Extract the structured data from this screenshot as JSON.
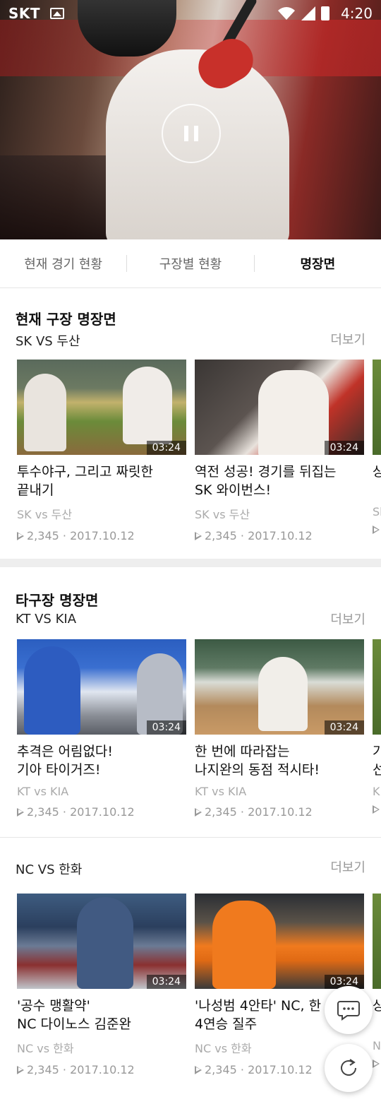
{
  "status_bar": {
    "carrier": "SKT",
    "time": "4:20"
  },
  "tabs": [
    {
      "label": "현재 경기 현황",
      "active": false
    },
    {
      "label": "구장별 현황",
      "active": false
    },
    {
      "label": "명장면",
      "active": true
    }
  ],
  "sections": [
    {
      "title": "현재 구장 명장면",
      "subtitle": "SK VS 두산",
      "more_label": "더보기",
      "cards": [
        {
          "title": "투수야구, 그리고 짜릿한\n끝내기",
          "match": "SK vs 두산",
          "views": "2,345",
          "date": "2017.10.12",
          "duration": "03:24"
        },
        {
          "title": "역전 성공! 경기를 뒤집는\nSK 와이번스!",
          "match": "SK vs 두산",
          "views": "2,345",
          "date": "2017.10.12",
          "duration": "03:24"
        },
        {
          "title": "상",
          "match": "Sl",
          "views": "",
          "date": "",
          "duration": ""
        }
      ]
    },
    {
      "title": "타구장 명장면",
      "subtitle": "KT VS KIA",
      "more_label": "더보기",
      "cards": [
        {
          "title": "추격은 어림없다!\n기아 타이거즈!",
          "match": "KT vs KIA",
          "views": "2,345",
          "date": "2017.10.12",
          "duration": "03:24"
        },
        {
          "title": "한 번에 따라잡는\n나지완의 동점 적시타!",
          "match": "KT vs KIA",
          "views": "2,345",
          "date": "2017.10.12",
          "duration": "03:24"
        },
        {
          "title": "가\n선",
          "match": "K",
          "views": "",
          "date": "",
          "duration": ""
        }
      ]
    },
    {
      "title": "",
      "subtitle": "NC VS 한화",
      "more_label": "더보기",
      "cards": [
        {
          "title": "'공수 맹활약'\nNC 다이노스 김준완",
          "match": "NC vs 한화",
          "views": "2,345",
          "date": "2017.10.12",
          "duration": "03:24"
        },
        {
          "title": "'나성범 4안타' NC, 한\n4연승 질주",
          "match": "NC vs 한화",
          "views": "2,345",
          "date": "2017.10.12",
          "duration": "03:24"
        },
        {
          "title": "상",
          "match": "N",
          "views": "",
          "date": "",
          "duration": ""
        }
      ]
    }
  ],
  "icons": {
    "chat": "chat-bubble-icon",
    "refresh": "refresh-icon",
    "pause": "pause-icon",
    "play": "play-icon"
  },
  "colors": {
    "active_tab": "#111111",
    "inactive_tab": "#666666",
    "muted": "#999999"
  }
}
